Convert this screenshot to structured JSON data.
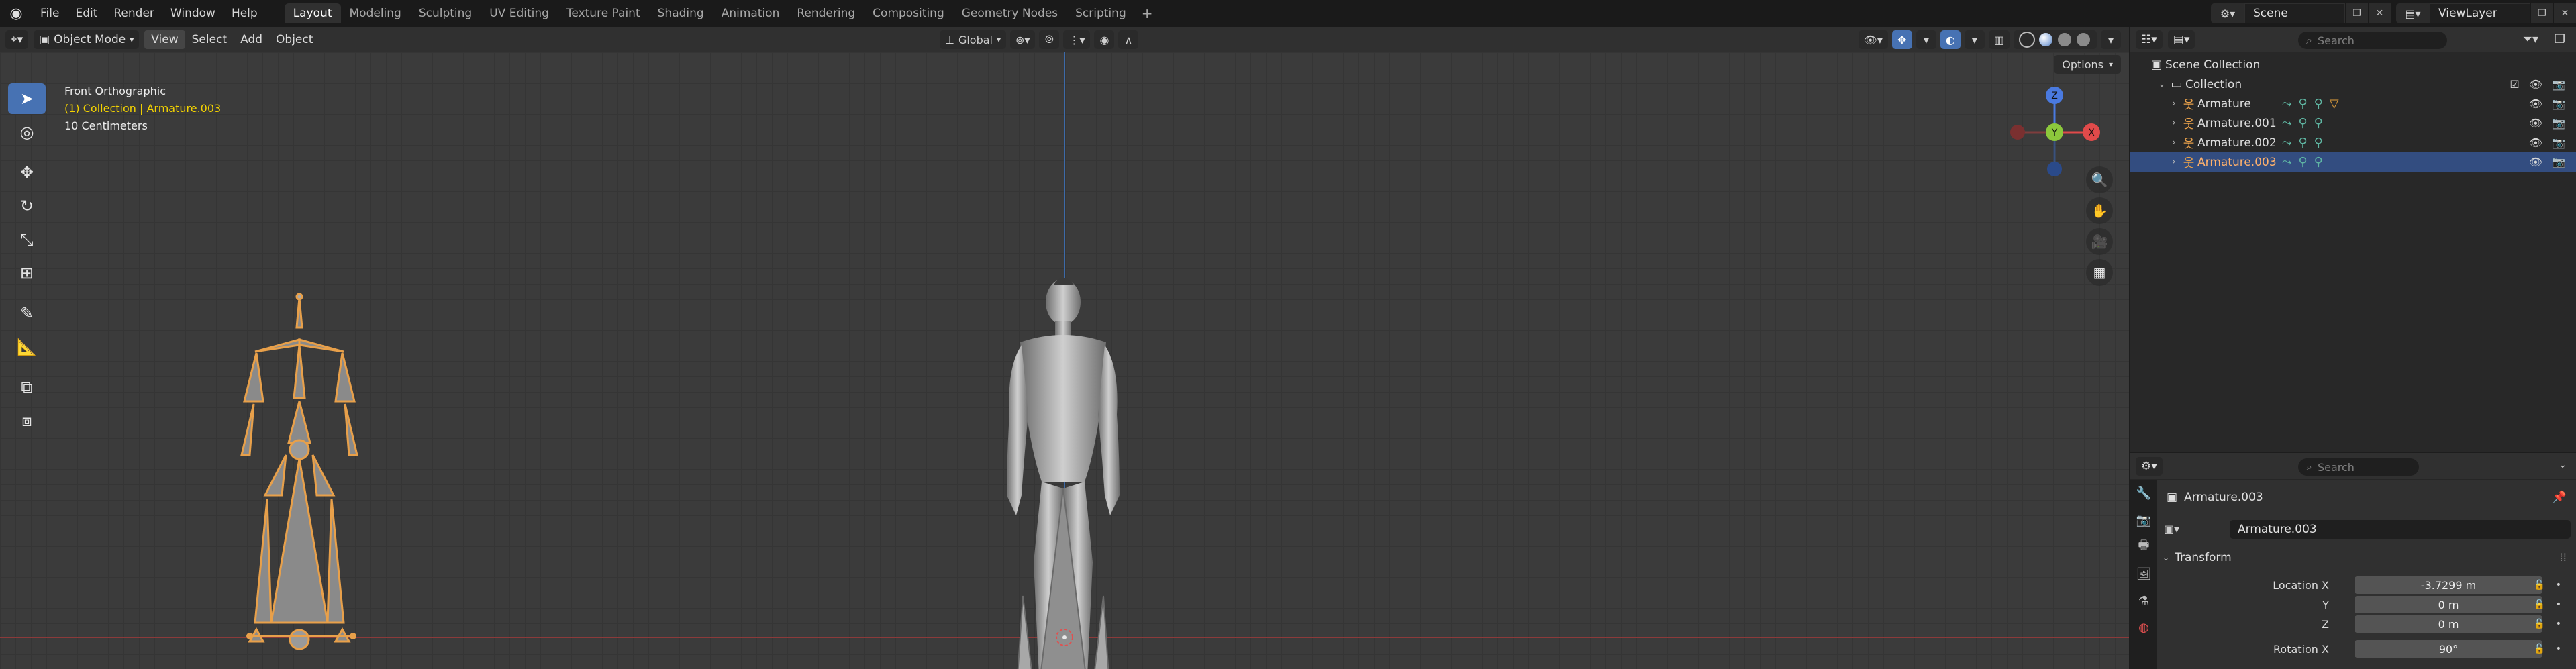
{
  "menu": [
    "File",
    "Edit",
    "Render",
    "Window",
    "Help"
  ],
  "workspaces": [
    {
      "label": "Layout",
      "active": true
    },
    {
      "label": "Modeling",
      "active": false
    },
    {
      "label": "Sculpting",
      "active": false
    },
    {
      "label": "UV Editing",
      "active": false
    },
    {
      "label": "Texture Paint",
      "active": false
    },
    {
      "label": "Shading",
      "active": false
    },
    {
      "label": "Animation",
      "active": false
    },
    {
      "label": "Rendering",
      "active": false
    },
    {
      "label": "Compositing",
      "active": false
    },
    {
      "label": "Geometry Nodes",
      "active": false
    },
    {
      "label": "Scripting",
      "active": false
    }
  ],
  "scene": {
    "name": "Scene",
    "view_layer": "ViewLayer"
  },
  "viewport_header": {
    "mode": "Object Mode",
    "menus": [
      "View",
      "Select",
      "Add",
      "Object"
    ],
    "transform_orientation": "Global"
  },
  "viewport": {
    "view_name": "Front Orthographic",
    "collection_info": "(1) Collection | Armature.003",
    "scale": "10 Centimeters",
    "options_label": "Options",
    "gizmo": {
      "z": "Z",
      "y": "Y",
      "x": "X"
    }
  },
  "outliner": {
    "search_placeholder": "Search",
    "scene_collection": "Scene Collection",
    "collection": "Collection",
    "items": [
      {
        "name": "Armature",
        "selected": false
      },
      {
        "name": "Armature.001",
        "selected": false
      },
      {
        "name": "Armature.002",
        "selected": false
      },
      {
        "name": "Armature.003",
        "selected": true
      }
    ]
  },
  "properties": {
    "search_placeholder": "Search",
    "object_title": "Armature.003",
    "object_name": "Armature.003",
    "section": "Transform",
    "rows": [
      {
        "label": "Location X",
        "value": "-3.7299 m"
      },
      {
        "label": "Y",
        "value": "0 m"
      },
      {
        "label": "Z",
        "value": "0 m"
      },
      {
        "label": "Rotation X",
        "value": "90°"
      }
    ]
  },
  "colors": {
    "accent": "#4772b3",
    "selected_text": "#ffb16c",
    "info_yellow": "#f4d300",
    "armature_orange": "#e8a04a"
  }
}
